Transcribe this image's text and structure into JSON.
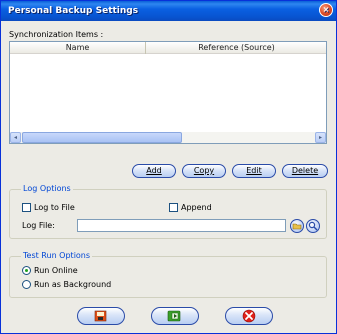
{
  "window": {
    "title": "Personal Backup Settings",
    "close_glyph": "×"
  },
  "sync": {
    "label": "Synchronization Items :",
    "columns": [
      "Name",
      "Reference (Source)"
    ],
    "scroll_left_glyph": "◂",
    "scroll_right_glyph": "▸"
  },
  "buttons": {
    "add": "Add",
    "copy": "Copy",
    "edit": "Edit",
    "delete": "Delete"
  },
  "log_options": {
    "title": "Log Options",
    "log_to_file": "Log to File",
    "append": "Append",
    "log_file_label": "Log File:",
    "log_file_value": ""
  },
  "test_run": {
    "title": "Test Run Options",
    "run_online": "Run Online",
    "run_background": "Run as Background",
    "selected": "Run Online"
  },
  "icons": [
    "close-icon",
    "browse-folder-icon",
    "view-log-icon",
    "save-icon",
    "run-icon",
    "cancel-icon"
  ],
  "colors": {
    "titlebar": "#0A5FD8",
    "group_title": "#0046D5",
    "cancel_red": "#E0201A",
    "run_green": "#3AA02A"
  }
}
